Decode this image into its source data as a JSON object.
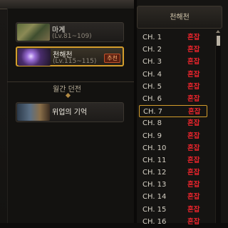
{
  "left": {
    "dungeons": [
      {
        "title": "마계",
        "level": "(Lv.81~109)",
        "thumb": "mage-dungeon-image",
        "selected": false
      },
      {
        "title": "천해천",
        "level": "(Lv.115~115)",
        "badge": "추천",
        "thumb": "cheonhaecheon-image",
        "selected": true
      }
    ],
    "weekly_header": "월간 던전",
    "weekly": [
      {
        "title": "위업의 기억",
        "thumb": "memory-of-feat-image"
      }
    ]
  },
  "right": {
    "title": "천해천",
    "channels": [
      {
        "name": "CH. 1",
        "status": "혼잡"
      },
      {
        "name": "CH. 2",
        "status": "혼잡"
      },
      {
        "name": "CH. 3",
        "status": "혼잡"
      },
      {
        "name": "CH. 4",
        "status": "혼잡"
      },
      {
        "name": "CH. 5",
        "status": "혼잡"
      },
      {
        "name": "CH. 6",
        "status": "혼잡"
      },
      {
        "name": "CH. 7",
        "status": "혼잡",
        "selected": true
      },
      {
        "name": "CH. 8",
        "status": "혼잡"
      },
      {
        "name": "CH. 9",
        "status": "혼잡"
      },
      {
        "name": "CH. 10",
        "status": "혼잡"
      },
      {
        "name": "CH. 11",
        "status": "혼잡"
      },
      {
        "name": "CH. 12",
        "status": "혼잡"
      },
      {
        "name": "CH. 13",
        "status": "혼잡"
      },
      {
        "name": "CH. 14",
        "status": "혼잡"
      },
      {
        "name": "CH. 15",
        "status": "혼잡"
      },
      {
        "name": "CH. 16",
        "status": "혼잡"
      }
    ]
  },
  "colors": {
    "accent": "#d39d2c",
    "status_busy": "#e8242c"
  }
}
